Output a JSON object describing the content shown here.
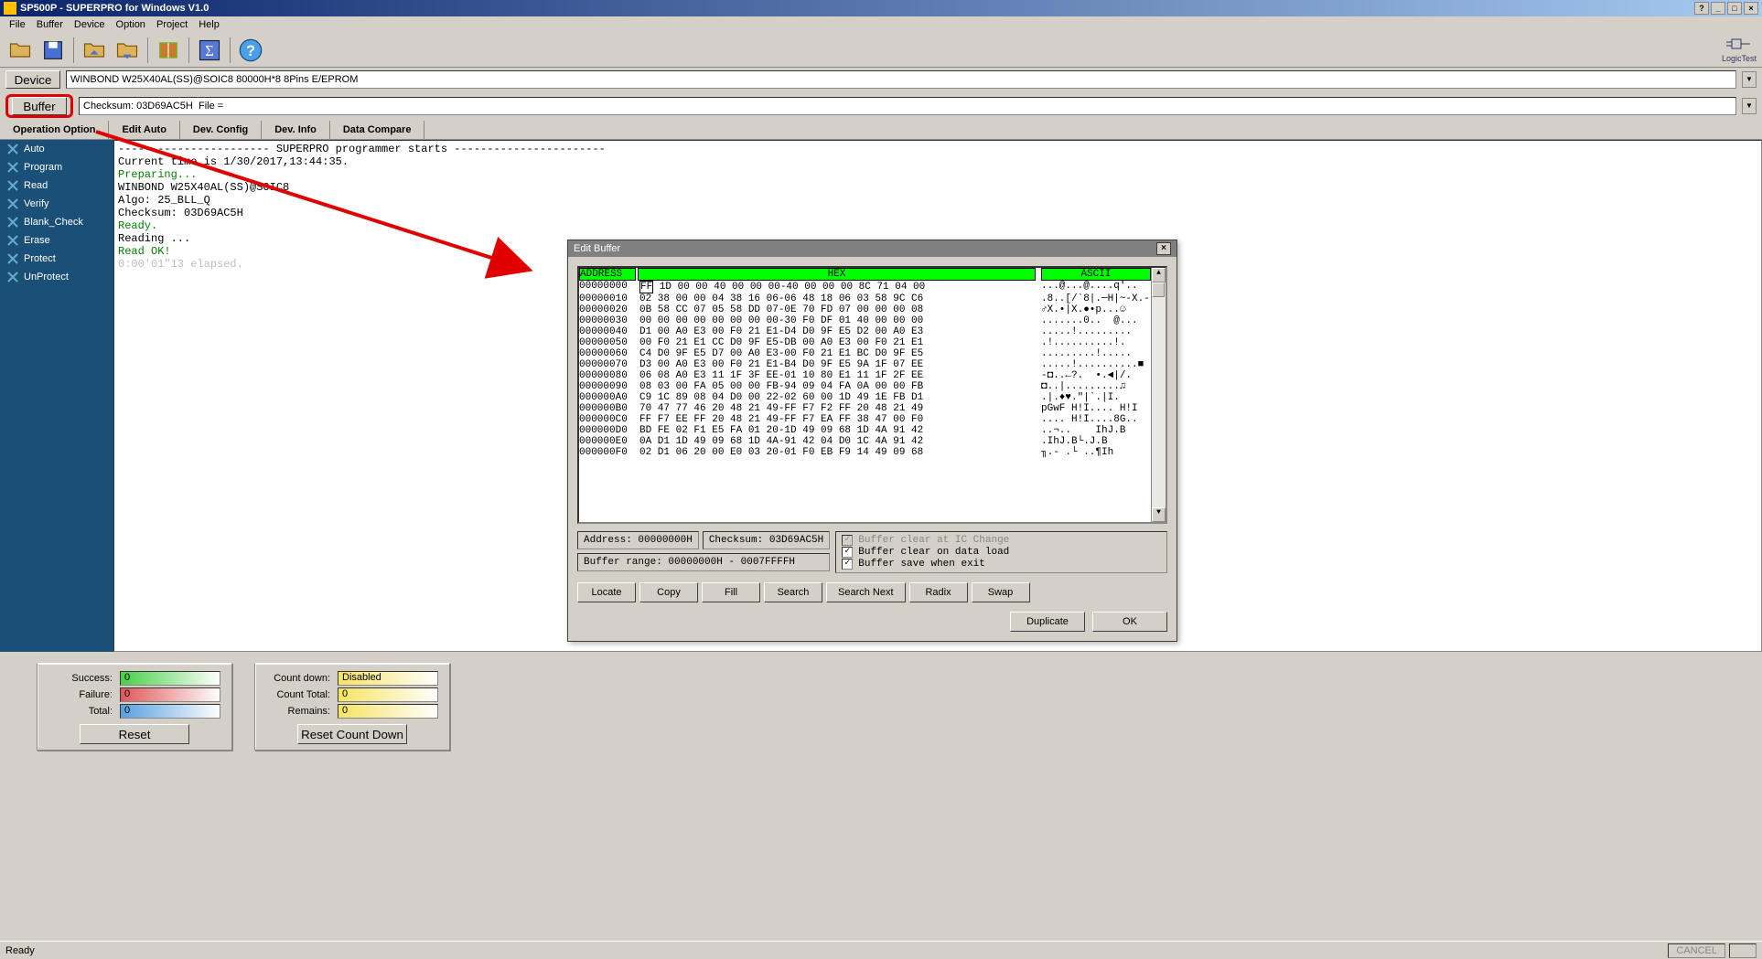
{
  "window": {
    "title": "SP500P - SUPERPRO for Windows V1.0"
  },
  "menu": [
    "File",
    "Buffer",
    "Device",
    "Option",
    "Project",
    "Help"
  ],
  "toolbar": {
    "logictest": "LogicTest"
  },
  "device_row": {
    "button": "Device",
    "value": "WINBOND W25X40AL(SS)@SOIC8  80000H*8  8Pins  E/EPROM"
  },
  "buffer_row": {
    "button": "Buffer",
    "checksum_label": "Checksum: 03D69AC5H",
    "file_label": "File ="
  },
  "tabs": [
    "Operation Option",
    "Edit Auto",
    "Dev. Config",
    "Dev. Info",
    "Data Compare"
  ],
  "sidebar": [
    {
      "label": "Auto"
    },
    {
      "label": "Program"
    },
    {
      "label": "Read"
    },
    {
      "label": "Verify"
    },
    {
      "label": "Blank_Check"
    },
    {
      "label": "Erase"
    },
    {
      "label": "Protect"
    },
    {
      "label": "UnProtect"
    }
  ],
  "console": [
    {
      "text": "----------------------- SUPERPRO programmer starts -----------------------",
      "cls": ""
    },
    {
      "text": "Current time is 1/30/2017,13:44:35.",
      "cls": ""
    },
    {
      "text": "Preparing...",
      "cls": "green"
    },
    {
      "text": "WINBOND W25X40AL(SS)@SOIC8",
      "cls": ""
    },
    {
      "text": "Algo: 25_BLL_Q",
      "cls": ""
    },
    {
      "text": "Checksum: 03D69AC5H",
      "cls": ""
    },
    {
      "text": "Ready.",
      "cls": "green"
    },
    {
      "text": "Reading ...",
      "cls": ""
    },
    {
      "text": "Read OK!",
      "cls": "green"
    },
    {
      "text": "0:00'01\"13 elapsed.",
      "cls": "gray"
    }
  ],
  "bottom": {
    "success_label": "Success:",
    "success_val": "0",
    "failure_label": "Failure:",
    "failure_val": "0",
    "total_label": "Total:",
    "total_val": "0",
    "reset_btn": "Reset",
    "countdown_label": "Count down:",
    "countdown_val": "Disabled",
    "counttotal_label": "Count Total:",
    "counttotal_val": "0",
    "remains_label": "Remains:",
    "remains_val": "0",
    "resetcount_btn": "Reset Count Down"
  },
  "status": {
    "ready": "Ready",
    "cancel": "CANCEL"
  },
  "dialog": {
    "title": "Edit Buffer",
    "headers": {
      "address": "ADDRESS",
      "hex": "HEX",
      "ascii": "ASCII"
    },
    "rows": [
      {
        "addr": "00000000",
        "hex": "FF 1D 00 00 40 00 00 00-40 00 00 00 8C 71 04 00",
        "asc": "...@...@....q'.."
      },
      {
        "addr": "00000010",
        "hex": "02 38 00 00 04 38 16 06-06 48 18 06 03 58 9C C6",
        "asc": ".8..[/`8|.─H|~-X.-"
      },
      {
        "addr": "00000020",
        "hex": "0B 58 CC 07 05 58 DD 07-0E 70 FD 07 00 00 00 08",
        "asc": "♂X.•|X.●•p...☺"
      },
      {
        "addr": "00000030",
        "hex": "00 00 00 00 00 00 00 00-30 F0 DF 01 40 00 00 00",
        "asc": ".......0..  @..."
      },
      {
        "addr": "00000040",
        "hex": "D1 00 A0 E3 00 F0 21 E1-D4 D0 9F E5 D2 00 A0 E3",
        "asc": ".....!........."
      },
      {
        "addr": "00000050",
        "hex": "00 F0 21 E1 CC D0 9F E5-DB 00 A0 E3 00 F0 21 E1",
        "asc": ".!..........!."
      },
      {
        "addr": "00000060",
        "hex": "C4 D0 9F E5 D7 00 A0 E3-00 F0 21 E1 BC D0 9F E5",
        "asc": ".........!....."
      },
      {
        "addr": "00000070",
        "hex": "D3 00 A0 E3 00 F0 21 E1-B4 D0 9F E5 9A 1F 07 EE",
        "asc": ".....!..........■"
      },
      {
        "addr": "00000080",
        "hex": "06 08 A0 E3 11 1F 3F EE-01 10 80 E1 11 1F 2F EE",
        "asc": "-◘..←?.  •.◄|/."
      },
      {
        "addr": "00000090",
        "hex": "08 03 00 FA 05 00 00 FB-94 09 04 FA 0A 00 00 FB",
        "asc": "◘..|.........♫"
      },
      {
        "addr": "000000A0",
        "hex": "C9 1C 89 08 04 D0 00 22-02 60 00 1D 49 1E FB D1",
        "asc": ".|.♦♥.\"|`.|I."
      },
      {
        "addr": "000000B0",
        "hex": "70 47 77 46 20 48 21 49-FF F7 F2 FF 20 48 21 49",
        "asc": "pGwF H!I.... H!I"
      },
      {
        "addr": "000000C0",
        "hex": "FF F7 EE FF 20 48 21 49-FF F7 EA FF 38 47 00 F0",
        "asc": ".... H!I....8G.."
      },
      {
        "addr": "000000D0",
        "hex": "BD FE 02 F1 E5 FA 01 20-1D 49 09 68 1D 4A 91 42",
        "asc": "..¬..    IhJ.B"
      },
      {
        "addr": "000000E0",
        "hex": "0A D1 1D 49 09 68 1D 4A-91 42 04 D0 1C 4A 91 42",
        "asc": ".IhJ.B└.J.B"
      },
      {
        "addr": "000000F0",
        "hex": "02 D1 06 20 00 E0 03 20-01 F0 EB F9 14 49 09 68",
        "asc": "╖.- .└ ..¶Ih"
      }
    ],
    "info": {
      "address": "Address: 00000000H",
      "checksum": "Checksum: 03D69AC5H",
      "range": "Buffer range: 00000000H - 0007FFFFH"
    },
    "checks": {
      "icchange": "Buffer clear at IC Change",
      "dataload": "Buffer clear on data load",
      "saveexit": "Buffer save when exit"
    },
    "buttons": [
      "Locate",
      "Copy",
      "Fill",
      "Search",
      "Search Next",
      "Radix",
      "Swap"
    ],
    "bottom_buttons": [
      "Duplicate",
      "OK"
    ]
  }
}
